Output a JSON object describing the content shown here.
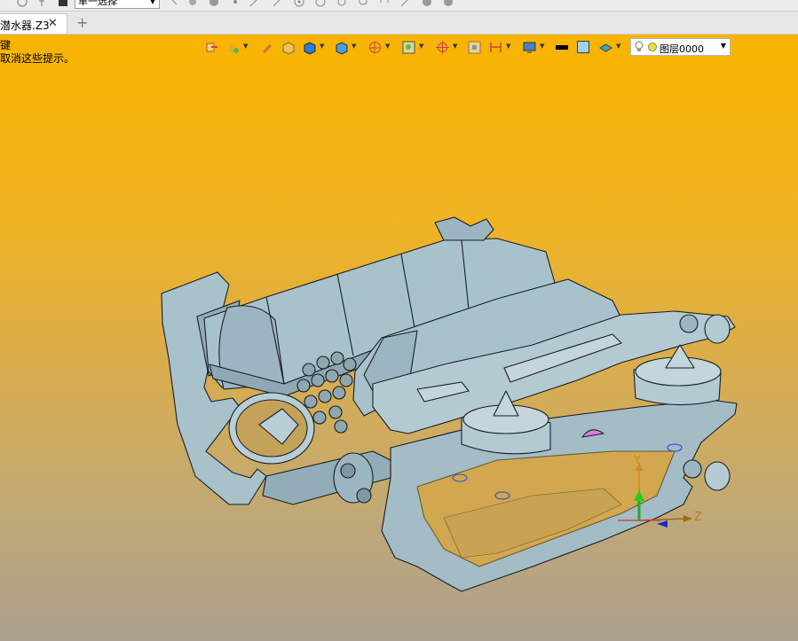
{
  "top_strip": {
    "selection_mode": "单一选择"
  },
  "tabs": [
    {
      "label": "潜水器.Z3"
    }
  ],
  "add_tab_label": "+",
  "close_tab_label": "✕",
  "viewport": {
    "hint_line1": "键",
    "hint_line2": "取消这些提示。",
    "layer": {
      "name": "图层0000"
    },
    "colors": {
      "background_top": "#f8b400",
      "background_bottom": "#aca08e",
      "model_fill": "#a8c2cc",
      "line_color": "#1a1e22",
      "layer_swatch": "#9fd0ee"
    },
    "toolbar_icons": [
      "exit-sketch-icon",
      "display-icon",
      "pen-icon",
      "shaded-cube-icon",
      "solid-cube-icon",
      "view-cube-icon",
      "rotate-sphere-icon",
      "zoom-window-icon",
      "snap-target-icon",
      "fit-view-icon",
      "dimension-icon",
      "monitor-icon",
      "line-color-icon",
      "fill-color-icon",
      "layer-stack-icon"
    ]
  },
  "triad": {
    "y": "Y",
    "z": "Z"
  }
}
